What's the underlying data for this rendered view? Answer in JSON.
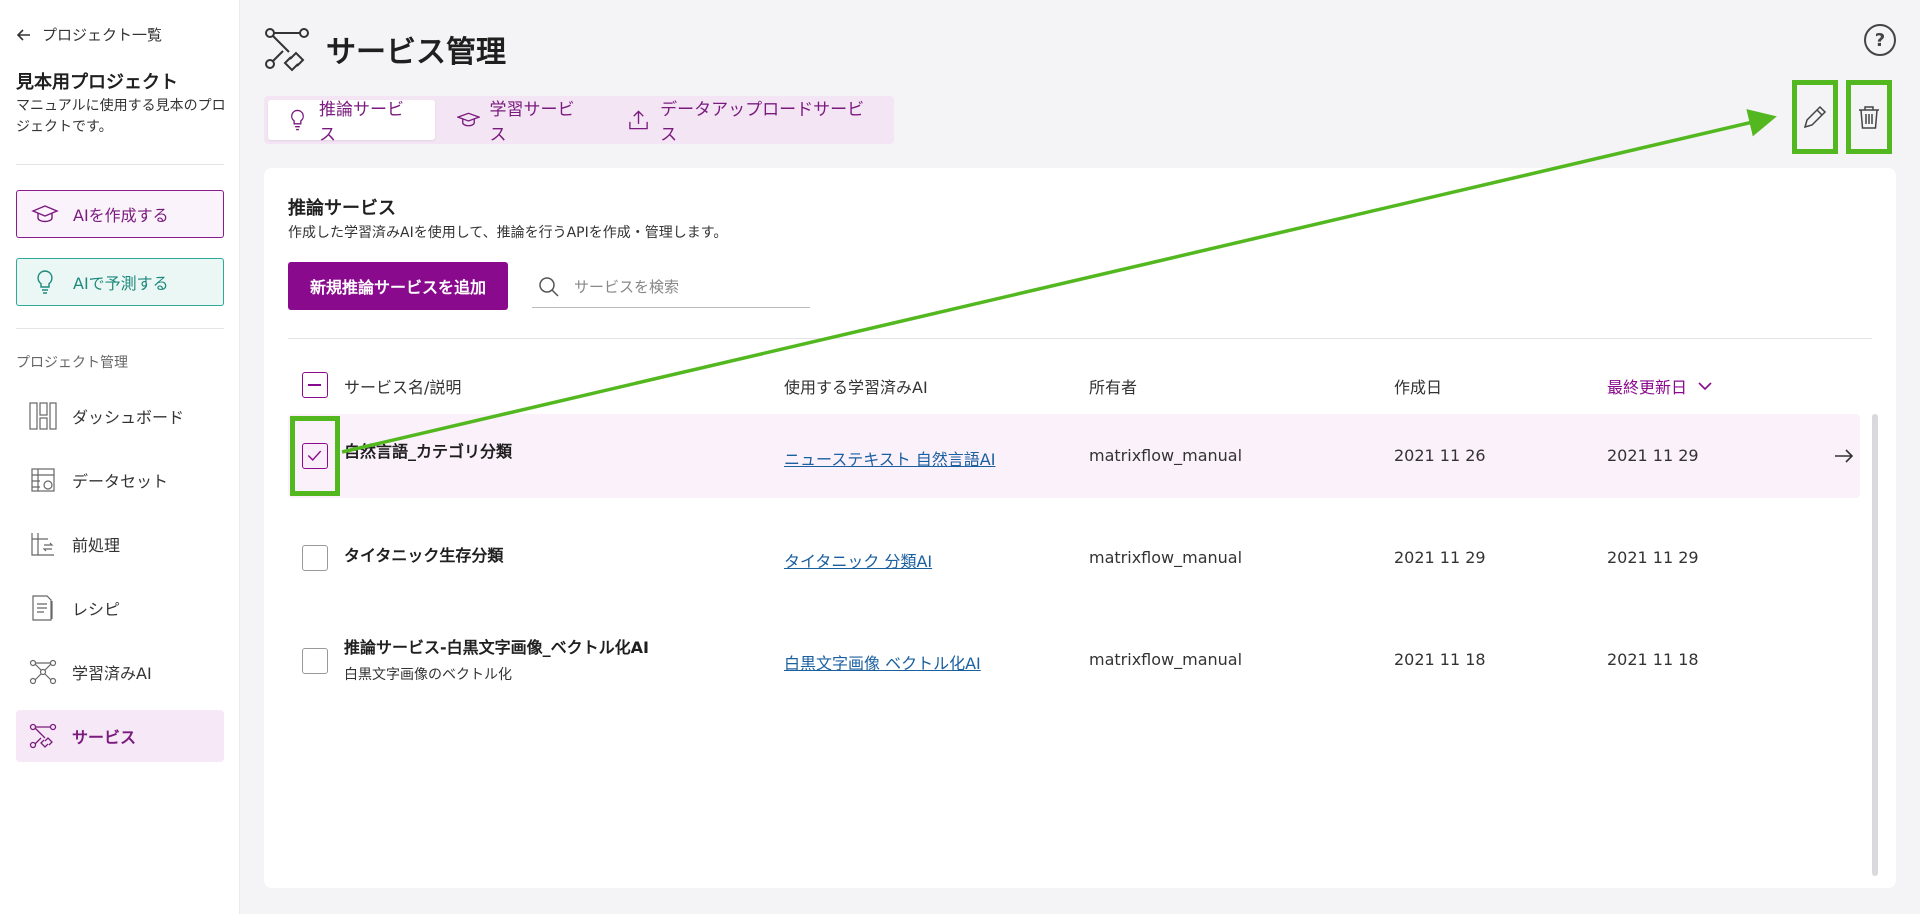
{
  "sidebar": {
    "back_label": "プロジェクト一覧",
    "project_name": "見本用プロジェクト",
    "project_description": "マニュアルに使用する見本のプロジェクトです。",
    "create_ai_label": "AIを作成する",
    "predict_ai_label": "AIで予測する",
    "section_label": "プロジェクト管理",
    "nav": [
      {
        "label": "ダッシュボード",
        "icon": "dashboard-icon"
      },
      {
        "label": "データセット",
        "icon": "dataset-icon"
      },
      {
        "label": "前処理",
        "icon": "preprocess-icon"
      },
      {
        "label": "レシピ",
        "icon": "recipe-icon"
      },
      {
        "label": "学習済みAI",
        "icon": "trained-ai-icon"
      },
      {
        "label": "サービス",
        "icon": "service-icon",
        "active": true
      }
    ]
  },
  "header": {
    "title": "サービス管理"
  },
  "tabs": [
    {
      "label": "推論サービス",
      "active": true
    },
    {
      "label": "学習サービス"
    },
    {
      "label": "データアップロードサービス"
    }
  ],
  "card": {
    "title": "推論サービス",
    "description": "作成した学習済みAIを使用して、推論を行うAPIを作成・管理します。",
    "add_button_label": "新規推論サービスを追加",
    "search_placeholder": "サービスを検索"
  },
  "table": {
    "columns": {
      "name": "サービス名/説明",
      "model": "使用する学習済みAI",
      "owner": "所有者",
      "created": "作成日",
      "updated": "最終更新日"
    },
    "rows": [
      {
        "name": "自然言語_カテゴリ分類",
        "description": "",
        "model": "ニューステキスト 自然言語AI",
        "owner": "matrixflow_manual",
        "created": "2021 11 26",
        "updated": "2021 11 29",
        "selected": true
      },
      {
        "name": "タイタニック生存分類",
        "description": "",
        "model": "タイタニック 分類AI",
        "owner": "matrixflow_manual",
        "created": "2021 11 29",
        "updated": "2021 11 29",
        "selected": false
      },
      {
        "name": "推論サービス-白黒文字画像_ベクトル化AI",
        "description": "白黒文字画像のベクトル化",
        "model": "白黒文字画像 ベクトル化AI",
        "owner": "matrixflow_manual",
        "created": "2021 11 18",
        "updated": "2021 11 18",
        "selected": false
      }
    ]
  },
  "colors": {
    "primary": "#8a0a8e",
    "teal": "#2fa89a",
    "highlight": "#53b81f",
    "link": "#1a5fa0"
  }
}
